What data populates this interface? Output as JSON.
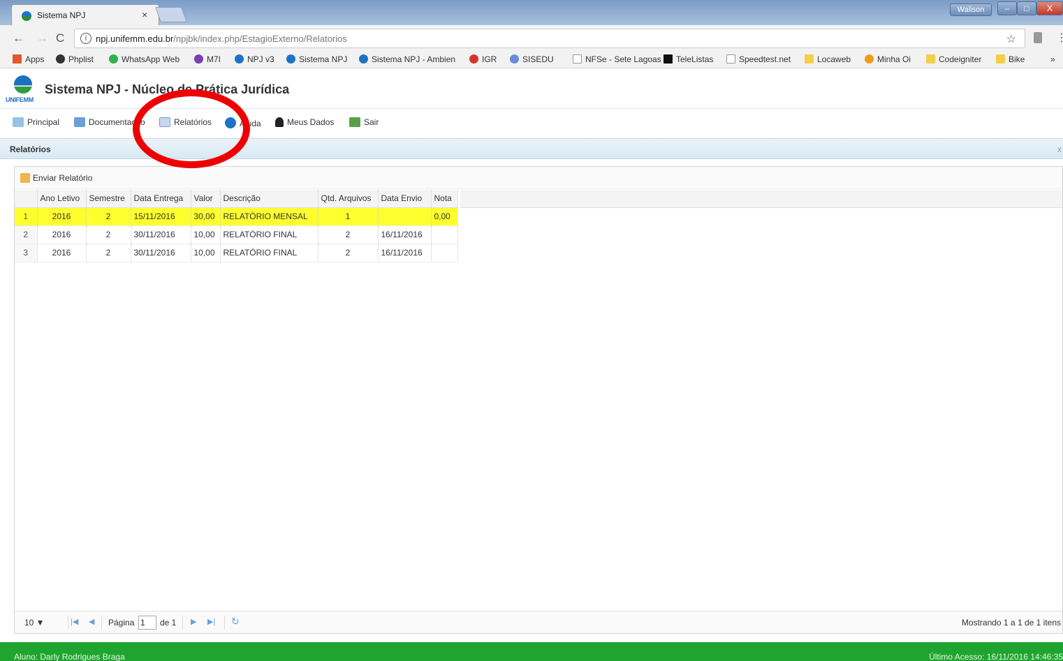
{
  "browser": {
    "tab_title": "Sistema NPJ",
    "tab_close": "×",
    "user_badge": "Walison",
    "window_buttons": {
      "min": "–",
      "max": "□",
      "close": "X"
    },
    "url_host": "npj.unifemm.edu.br",
    "url_path": "/npjbk/index.php/EstagioExterno/Relatorios",
    "bookmarks": [
      "Apps",
      "Phplist",
      "WhatsApp Web",
      "M7I",
      "NPJ v3",
      "Sistema NPJ",
      "Sistema NPJ - Ambien",
      "IGR",
      "SISEDU",
      "NFSe - Sete Lagoas",
      "TeleListas",
      "Speedtest.net",
      "Locaweb",
      "Minha Oi",
      "Codeigniter",
      "Bike",
      "»"
    ]
  },
  "app": {
    "logo_text": "UNIFEMM",
    "title": "Sistema NPJ - Núcleo de Prática Jurídica",
    "menu": [
      "Principal",
      "Documentação",
      "Relatórios",
      "Ajuda",
      "Meus Dados",
      "Sair"
    ]
  },
  "panel": {
    "title": "Relatórios",
    "close": "x",
    "toolbar_button": "Enviar Relatório"
  },
  "grid": {
    "columns": [
      "Ano Letivo",
      "Semestre",
      "Data Entrega",
      "Valor",
      "Descrição",
      "Qtd. Arquivos",
      "Data Envio",
      "Nota"
    ],
    "rows": [
      {
        "n": "1",
        "ano": "2016",
        "sem": "2",
        "entrega": "15/11/2016",
        "valor": "30,00",
        "desc": "RELATÓRIO MENSAL",
        "qtd": "1",
        "envio": "",
        "nota": "0,00"
      },
      {
        "n": "2",
        "ano": "2016",
        "sem": "2",
        "entrega": "30/11/2016",
        "valor": "10,00",
        "desc": "RELATÓRIO FINAL",
        "qtd": "2",
        "envio": "16/11/2016",
        "nota": ""
      },
      {
        "n": "3",
        "ano": "2016",
        "sem": "2",
        "entrega": "30/11/2016",
        "valor": "10,00",
        "desc": "RELATÓRIO FINAL",
        "qtd": "2",
        "envio": "16/11/2016",
        "nota": ""
      }
    ]
  },
  "pager": {
    "page_size": "10 ▼",
    "page_label": "Página",
    "page_value": "1",
    "of_label": "de 1",
    "info": "Mostrando 1 a 1 de 1 itens"
  },
  "status": {
    "left": "Aluno: Darly Rodrigues Braga",
    "right": "Último Acesso: 16/11/2016 14:46:35"
  },
  "colors": {
    "status_green": "#1fa52f",
    "highlight_yellow": "#ffff2e",
    "annotation_red": "#ee0000"
  }
}
